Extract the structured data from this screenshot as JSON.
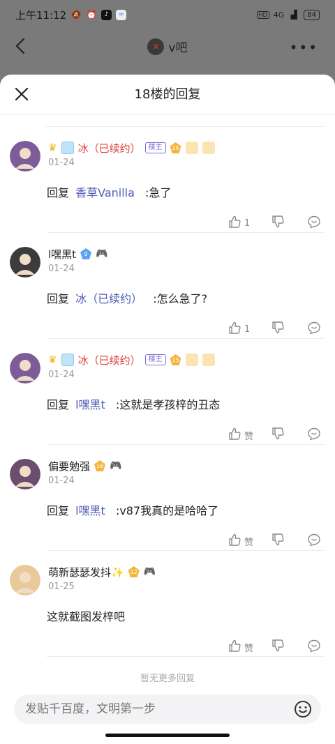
{
  "status": {
    "time": "上午11:12",
    "signal": "4G",
    "battery": "84"
  },
  "topbar": {
    "forum_name": "v吧"
  },
  "sheet": {
    "title": "18楼的回复"
  },
  "replies": [
    {
      "name": "冰（已续约）",
      "badge": "楼主",
      "level": "15",
      "date": "01-24",
      "prefix": "回复",
      "at": "香草Vanilla",
      "text": ":急了",
      "likes": "1",
      "avatar_color": "#7d5c9a"
    },
    {
      "name": "l嘿黑t",
      "badge": "",
      "level": "9",
      "date": "01-24",
      "prefix": "回复",
      "at": "冰（已续约）",
      "text": ":怎么急了?",
      "likes": "1",
      "avatar_color": "#3c3c3c"
    },
    {
      "name": "冰（已续约）",
      "badge": "楼主",
      "level": "15",
      "date": "01-24",
      "prefix": "回复",
      "at": "l嘿黑t",
      "text": ":这就是孝孩梓的丑态",
      "likes": "赞",
      "avatar_color": "#7d5c9a"
    },
    {
      "name": "偏要勉强",
      "badge": "",
      "level": "16",
      "date": "01-24",
      "prefix": "回复",
      "at": "l嘿黑t",
      "text": ":v87我真的是哈哈了",
      "likes": "赞",
      "avatar_color": "#6b4e6e"
    },
    {
      "name": "萌新瑟瑟发抖✨",
      "badge": "",
      "level": "12",
      "date": "01-25",
      "prefix": "",
      "at": "",
      "text": "这就截图发梓吧",
      "likes": "赞",
      "avatar_color": "#e8c99a"
    }
  ],
  "footer": {
    "no_more": "暂无更多回复",
    "input_placeholder": "发贴千百度，文明第一步"
  }
}
